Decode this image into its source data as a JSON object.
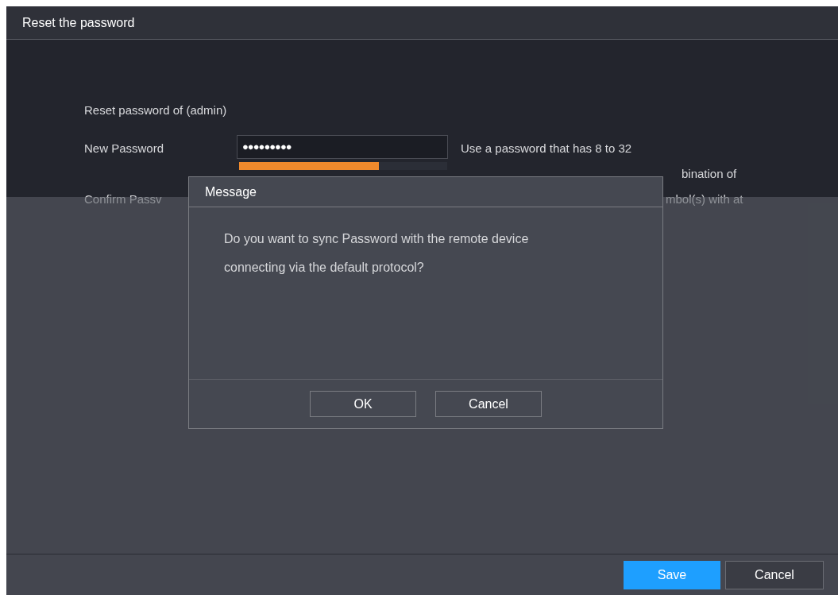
{
  "window": {
    "title": "Reset the password"
  },
  "form": {
    "heading": "Reset password of (admin)",
    "new_password": {
      "label": "New Password",
      "value": "●●●●●●●●●"
    },
    "strength": {
      "level": 0.67
    },
    "confirm_password": {
      "label": "Confirm Passv"
    },
    "hint_lines": [
      "Use a password that has 8 to 32",
      "bination of",
      "mbol(s) with at"
    ]
  },
  "dialog": {
    "title": "Message",
    "text": "Do you want to sync Password with the remote device connecting via the default protocol?",
    "buttons": [
      "OK",
      "Cancel"
    ]
  },
  "footer": {
    "buttons": [
      {
        "label": "Save",
        "kind": "primary"
      },
      {
        "label": "Cancel",
        "kind": "secondary"
      }
    ]
  }
}
